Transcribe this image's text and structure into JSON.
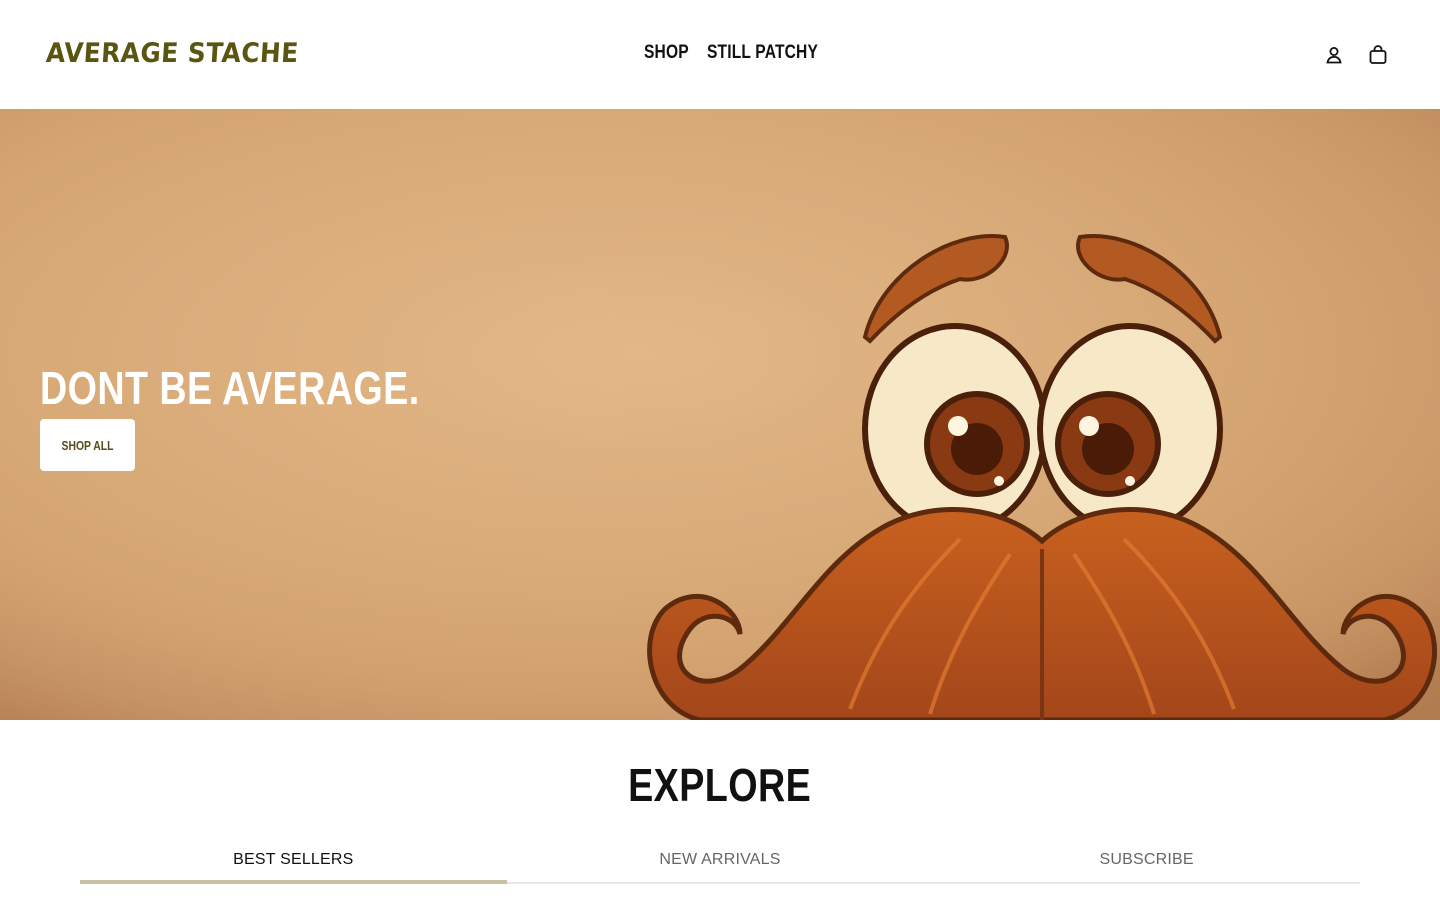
{
  "header": {
    "logo": "AVERAGE STACHE",
    "nav": [
      {
        "label": "SHOP"
      },
      {
        "label": "STILL PATCHY"
      }
    ],
    "icons": [
      "account-icon",
      "cart-icon"
    ]
  },
  "hero": {
    "title": "DONT BE AVERAGE.",
    "button_label": "SHOP ALL",
    "background_color": "#d8aa78",
    "accent_color": "#b55a1e"
  },
  "explore": {
    "title": "EXPLORE",
    "tabs": [
      {
        "label": "BEST SELLERS",
        "active": true
      },
      {
        "label": "NEW ARRIVALS",
        "active": false
      },
      {
        "label": "SUBSCRIBE",
        "active": false
      }
    ],
    "active_tab_color": "#c9c1a3"
  }
}
